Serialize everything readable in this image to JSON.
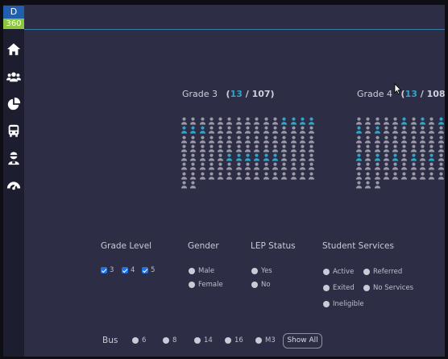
{
  "logo": {
    "top": "D",
    "bottom": "360"
  },
  "sidebar": {
    "items": [
      {
        "name": "home-icon"
      },
      {
        "name": "students-icon"
      },
      {
        "name": "pie-chart-icon"
      },
      {
        "name": "bus-icon"
      },
      {
        "name": "driver-icon"
      },
      {
        "name": "dashboard-gauge-icon"
      }
    ]
  },
  "grades": [
    {
      "label": "Grade 3",
      "highlighted": "13",
      "total": "107",
      "open": "(",
      "sep": " / ",
      "close": ")"
    },
    {
      "label": "Grade 4",
      "highlighted": "13",
      "total": "108",
      "open": "(",
      "sep": " / ",
      "close": ")"
    }
  ],
  "filters": {
    "grade_level": {
      "title": "Grade Level",
      "options": [
        "3",
        "4",
        "5"
      ]
    },
    "gender": {
      "title": "Gender",
      "options": [
        "Male",
        "Female"
      ]
    },
    "lep_status": {
      "title": "LEP Status",
      "options": [
        "Yes",
        "No"
      ]
    },
    "student_services": {
      "title": "Student Services",
      "options": [
        "Active",
        "Referred",
        "Exited",
        "No Services",
        "Ineligible"
      ]
    }
  },
  "bus": {
    "label": "Bus",
    "options": [
      "6",
      "8",
      "14",
      "16",
      "M3"
    ],
    "show_all": "Show All"
  },
  "colors": {
    "accent": "#2fa6c8",
    "person_default": "#9a9aa8",
    "background": "#2d2d45",
    "sidebar": "#1d1d30"
  }
}
